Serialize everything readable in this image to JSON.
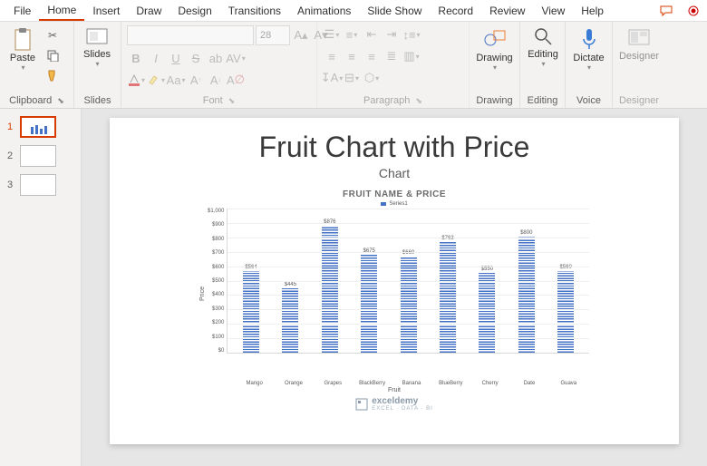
{
  "menu": {
    "items": [
      "File",
      "Home",
      "Insert",
      "Draw",
      "Design",
      "Transitions",
      "Animations",
      "Slide Show",
      "Record",
      "Review",
      "View",
      "Help"
    ],
    "active": 1
  },
  "ribbon": {
    "clipboard": {
      "paste": "Paste",
      "label": "Clipboard"
    },
    "slides": {
      "btn": "Slides",
      "label": "Slides"
    },
    "font": {
      "size": "28",
      "label": "Font"
    },
    "paragraph": {
      "label": "Paragraph"
    },
    "drawing": {
      "btn": "Drawing",
      "label": "Drawing"
    },
    "editing": {
      "btn": "Editing",
      "label": "Editing"
    },
    "voice": {
      "btn": "Dictate",
      "label": "Voice"
    },
    "designer": {
      "btn": "Designer",
      "label": "Designer"
    }
  },
  "thumbs": [
    1,
    2,
    3
  ],
  "slide": {
    "title": "Fruit Chart with Price",
    "subtitle": "Chart",
    "chartTitle": "FRUIT NAME & PRICE",
    "legend": "Series1",
    "ylabel": "Price",
    "xlabel": "Fruit",
    "watermark": "exceldemy",
    "watermarkSub": "EXCEL · DATA · BI"
  },
  "chart_data": {
    "type": "bar",
    "categories": [
      "Mango",
      "Orange",
      "Grapes",
      "BlackBerry",
      "Banana",
      "BlueBerry",
      "Cherry",
      "Date",
      "Guava"
    ],
    "values": [
      564,
      445,
      876,
      675,
      660,
      763,
      550,
      800,
      560
    ],
    "labels": [
      "$564",
      "$445",
      "$876",
      "$675",
      "$660",
      "$763",
      "$550",
      "$800",
      "$560"
    ],
    "title": "FRUIT NAME & PRICE",
    "xlabel": "Fruit",
    "ylabel": "Price",
    "ylim": [
      0,
      1000
    ],
    "yticks": [
      "$1,000",
      "$900",
      "$800",
      "$700",
      "$600",
      "$500",
      "$400",
      "$300",
      "$200",
      "$100",
      "$0"
    ],
    "series": [
      {
        "name": "Series1"
      }
    ]
  }
}
